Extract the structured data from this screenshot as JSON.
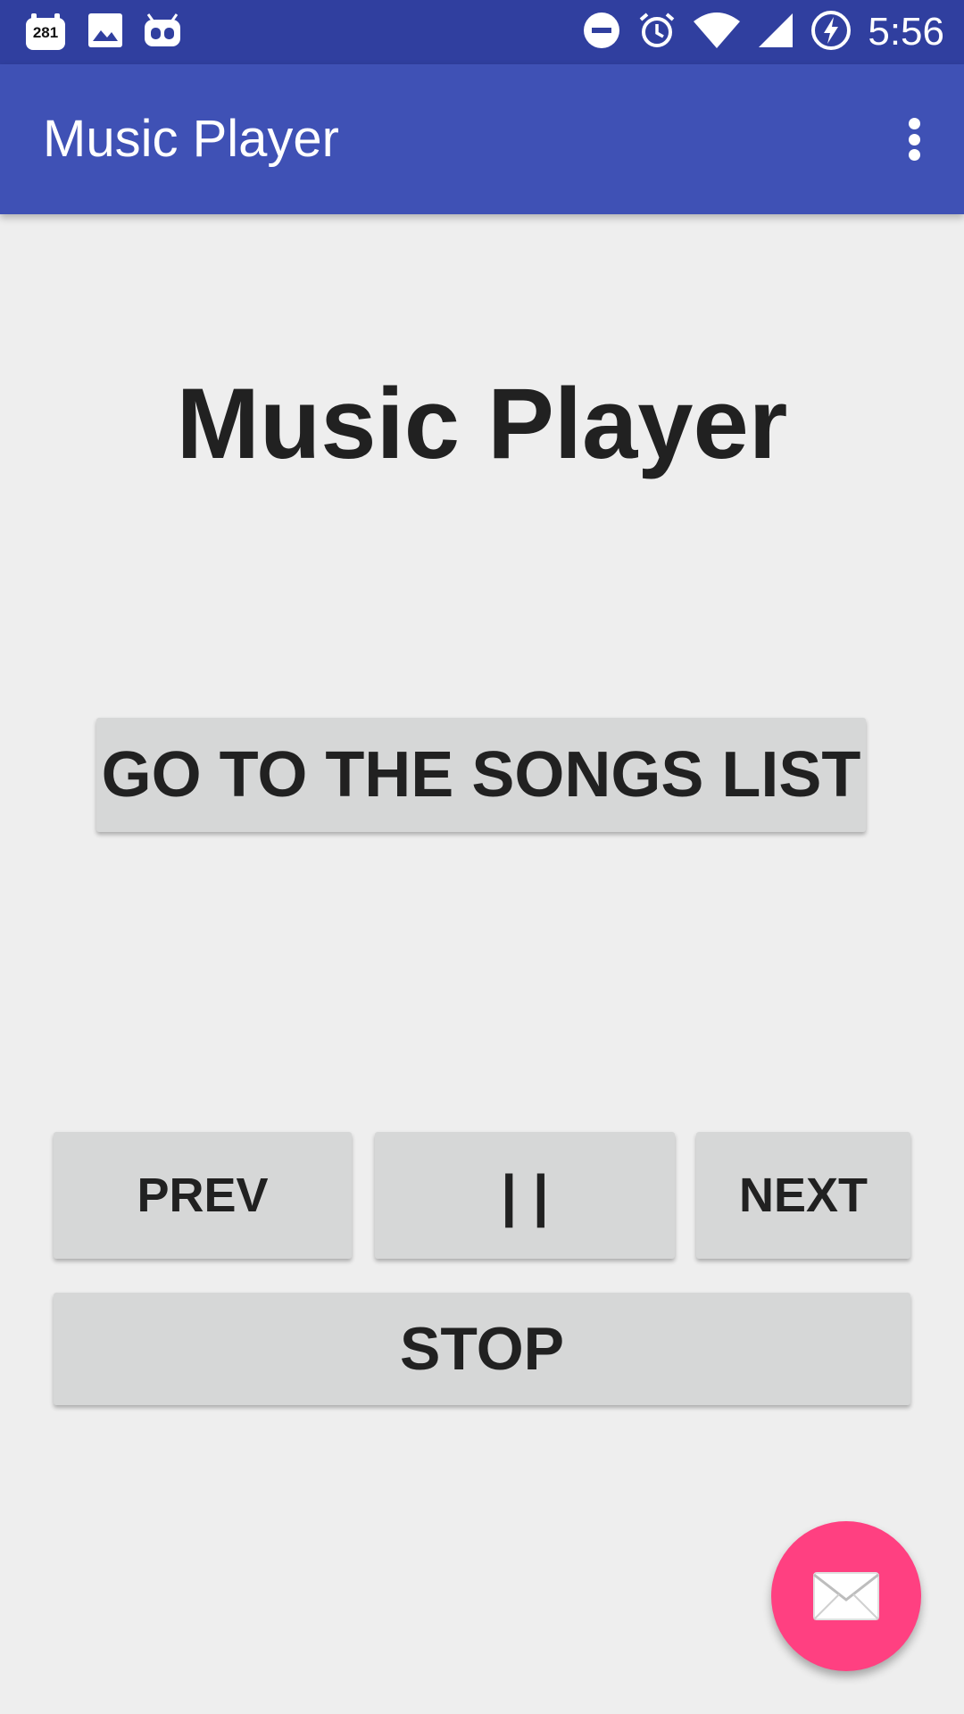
{
  "status_bar": {
    "notification_count": "281",
    "time": "5:56",
    "icons": [
      "calendar-notification-icon",
      "image-icon",
      "android-robot-icon",
      "do-not-disturb-icon",
      "alarm-icon",
      "wifi-icon",
      "cell-signal-icon",
      "battery-charging-icon"
    ]
  },
  "app_bar": {
    "title": "Music Player",
    "overflow_icon": "more-vert-icon"
  },
  "main": {
    "heading": "Music Player",
    "songs_button": "GO TO THE SONGS LIST",
    "prev_button": "PREV",
    "pause_button": "| |",
    "next_button": "NEXT",
    "stop_button": "STOP"
  },
  "fab": {
    "icon": "email-icon"
  },
  "colors": {
    "status_bar": "#303f9f",
    "app_bar": "#3f51b5",
    "background": "#eeeeee",
    "button": "#d6d7d7",
    "fab": "#ff4081"
  }
}
